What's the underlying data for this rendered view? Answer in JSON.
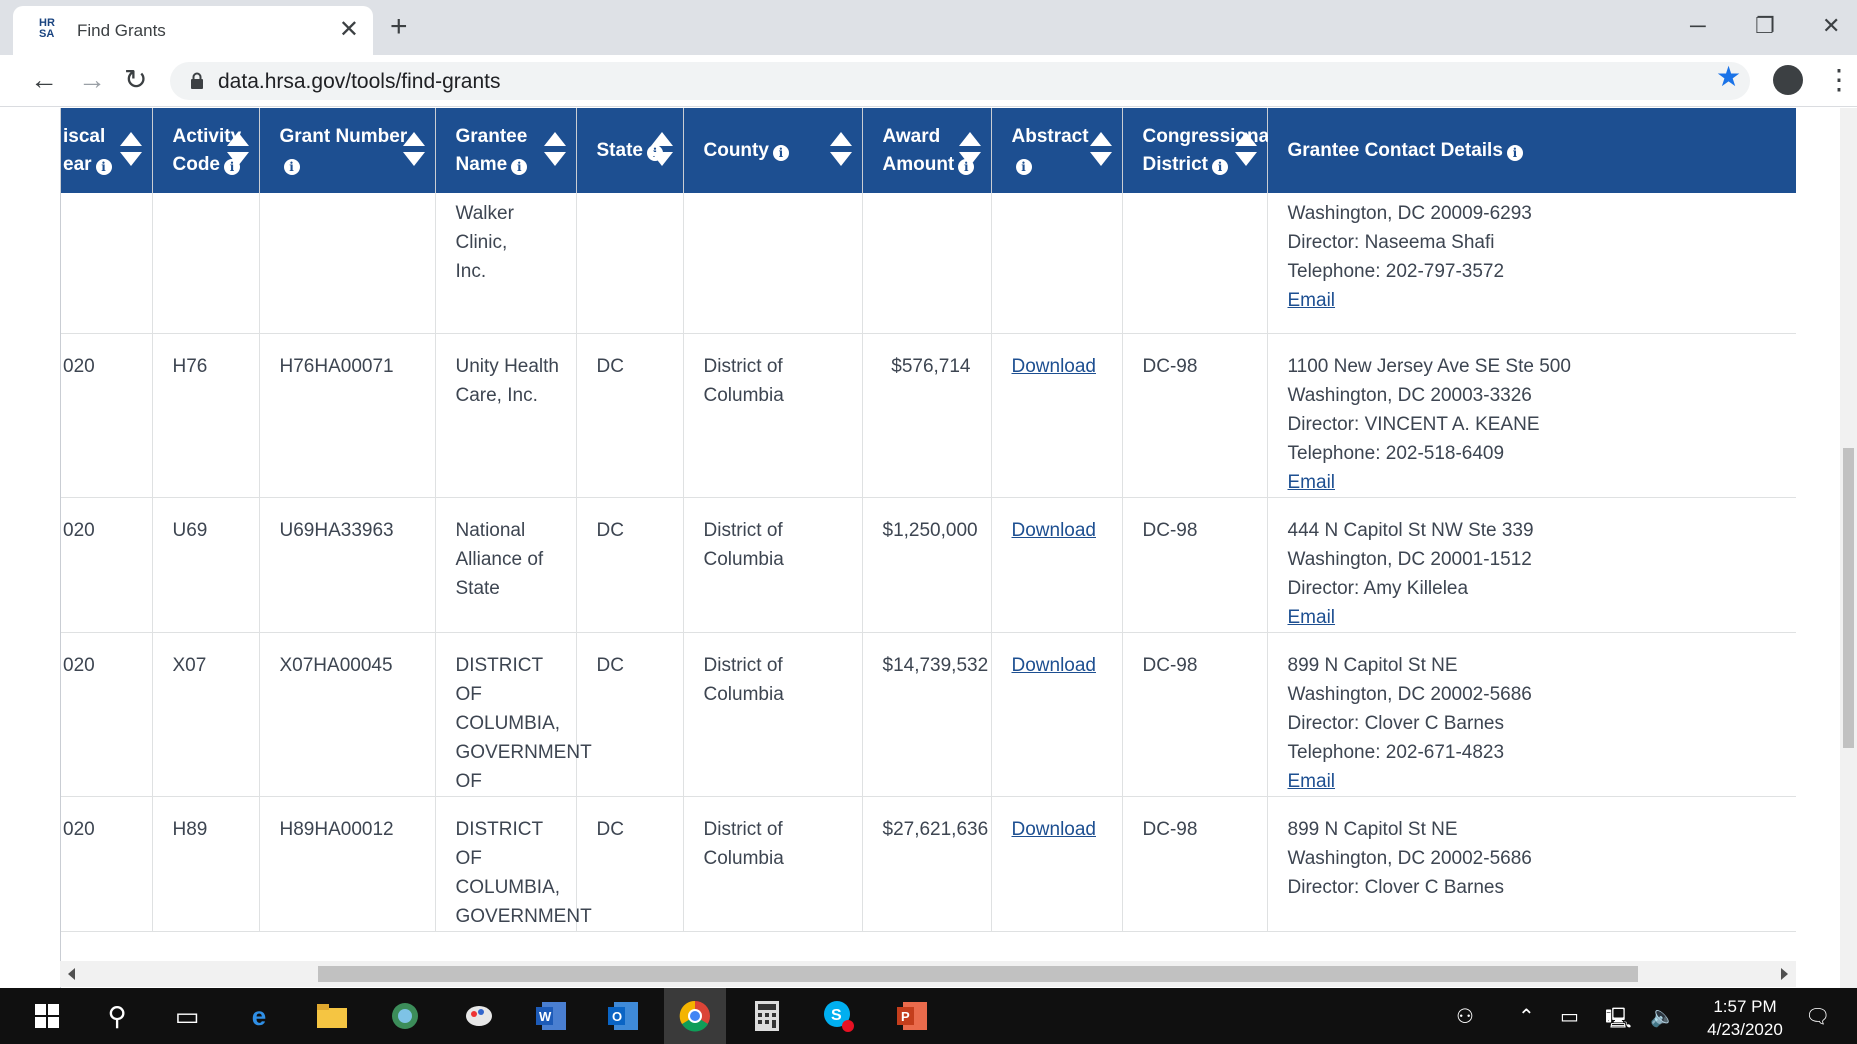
{
  "browser": {
    "tab_title": "Find Grants",
    "favicon_text": "HRSA",
    "url": "data.hrsa.gov/tools/find-grants"
  },
  "table": {
    "headers": [
      {
        "label": "Fiscal Year",
        "shown": "iscal ear"
      },
      {
        "label": "Activity Code"
      },
      {
        "label": "Grant Number"
      },
      {
        "label": "Grantee Name"
      },
      {
        "label": "State"
      },
      {
        "label": "County"
      },
      {
        "label": "Award Amount"
      },
      {
        "label": "Abstract"
      },
      {
        "label": "Congressional District"
      },
      {
        "label": "Grantee Contact Details"
      }
    ],
    "partial_row": {
      "grantee_name": [
        "Walker Clinic,",
        "Inc."
      ],
      "contact": [
        "Washington, DC 20009-6293",
        "Director: Naseema Shafi",
        "Telephone: 202-797-3572"
      ],
      "email_label": "Email"
    },
    "rows": [
      {
        "fiscal_year": "020",
        "activity_code": "H76",
        "grant_number": "H76HA00071",
        "grantee_name": [
          "Unity Health",
          "Care, Inc."
        ],
        "state": "DC",
        "county": "District of Columbia",
        "award_amount": "$576,714",
        "abstract_link": "Download",
        "district": "DC-98",
        "contact": [
          "1100 New Jersey Ave SE Ste 500",
          "Washington, DC 20003-3326",
          "Director: VINCENT A. KEANE",
          "Telephone: 202-518-6409"
        ],
        "email_label": "Email"
      },
      {
        "fiscal_year": "020",
        "activity_code": "U69",
        "grant_number": "U69HA33963",
        "grantee_name": [
          "National",
          "Alliance of",
          "State"
        ],
        "state": "DC",
        "county": "District of Columbia",
        "award_amount": "$1,250,000",
        "abstract_link": "Download",
        "district": "DC-98",
        "contact": [
          "444 N Capitol St NW Ste 339",
          "Washington, DC 20001-1512",
          "Director: Amy Killelea"
        ],
        "email_label": "Email"
      },
      {
        "fiscal_year": "020",
        "activity_code": "X07",
        "grant_number": "X07HA00045",
        "grantee_name": [
          "DISTRICT OF",
          "COLUMBIA,",
          "GOVERNMENT",
          "OF"
        ],
        "state": "DC",
        "county": "District of Columbia",
        "award_amount": "$14,739,532",
        "abstract_link": "Download",
        "district": "DC-98",
        "contact": [
          "899 N Capitol St NE",
          "Washington, DC 20002-5686",
          "Director: Clover C Barnes",
          "Telephone: 202-671-4823"
        ],
        "email_label": "Email"
      },
      {
        "fiscal_year": "020",
        "activity_code": "H89",
        "grant_number": "H89HA00012",
        "grantee_name": [
          "DISTRICT OF",
          "COLUMBIA,",
          "GOVERNMENT"
        ],
        "state": "DC",
        "county": "District of Columbia",
        "award_amount": "$27,621,636",
        "abstract_link": "Download",
        "district": "DC-98",
        "contact": [
          "899 N Capitol St NE",
          "Washington, DC 20002-5686",
          "Director: Clover C Barnes"
        ],
        "email_label": ""
      }
    ]
  },
  "taskbar": {
    "time": "1:57 PM",
    "date": "4/23/2020",
    "apps": [
      "start-icon",
      "search-icon",
      "task-view-icon",
      "edge-icon",
      "file-explorer-icon",
      "maps-icon",
      "paint-icon",
      "word-icon",
      "outlook-icon",
      "chrome-icon",
      "calculator-icon",
      "skype-icon",
      "powerpoint-icon"
    ]
  },
  "colors": {
    "header_bg": "#1d4f91",
    "link": "#1d4f91",
    "star": "#1a73e8"
  }
}
